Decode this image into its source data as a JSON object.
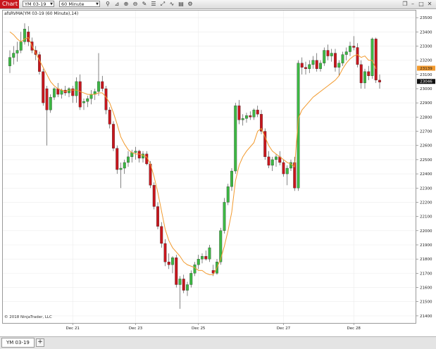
{
  "toolbar": {
    "tab_label": "Chart",
    "instrument": "YM 03-19",
    "interval": "60 Minute",
    "tools": [
      "search-icon",
      "zoom-in-icon",
      "zoom-out-icon",
      "bar-type-icon",
      "pen-icon",
      "properties-icon",
      "indicator-icon",
      "strategy-icon",
      "window-icon",
      "link-icon"
    ],
    "window_buttons": [
      "restore",
      "minimize",
      "maximize",
      "close"
    ]
  },
  "indicator_label": "afsRVMA(YM 03-19 (60 Minute),14)",
  "copyright": "© 2018 NinjaTrader, LLC",
  "bottom_tab": "YM 03-19",
  "add_tab": "+",
  "colors": {
    "up": "#3cb843",
    "down": "#c8161d",
    "ma": "#f29a2e",
    "last": "#111111"
  },
  "chart_data": {
    "type": "candlestick",
    "title": "",
    "ylim": [
      21350,
      23550
    ],
    "yticks": [
      21400,
      21500,
      21600,
      21700,
      21800,
      21900,
      22000,
      22100,
      22200,
      22300,
      22400,
      22500,
      22600,
      22700,
      22800,
      22900,
      23000,
      23100,
      23200,
      23300,
      23400,
      23500
    ],
    "xticks": [
      {
        "label": "Dec 21",
        "i": 17
      },
      {
        "label": "Dec 23",
        "i": 34
      },
      {
        "label": "Dec 25",
        "i": 51
      },
      {
        "label": "Dec 27",
        "i": 74
      },
      {
        "label": "Dec 28",
        "i": 93
      }
    ],
    "ma_badge": "23139",
    "last_badge": "23046",
    "candles": [
      [
        23160,
        23270,
        23110,
        23220
      ],
      [
        23220,
        23300,
        23170,
        23250
      ],
      [
        23250,
        23330,
        23190,
        23270
      ],
      [
        23270,
        23400,
        23250,
        23330
      ],
      [
        23330,
        23460,
        23310,
        23420
      ],
      [
        23400,
        23440,
        23300,
        23330
      ],
      [
        23330,
        23360,
        23250,
        23270
      ],
      [
        23270,
        23300,
        23200,
        23240
      ],
      [
        23240,
        23260,
        23100,
        23120
      ],
      [
        23120,
        23140,
        22880,
        22900
      ],
      [
        23000,
        23020,
        22600,
        22850
      ],
      [
        22850,
        22960,
        22830,
        22940
      ],
      [
        22940,
        23010,
        22920,
        23000
      ],
      [
        23000,
        23040,
        22940,
        22960
      ],
      [
        22960,
        23000,
        22930,
        22990
      ],
      [
        22990,
        23020,
        22950,
        22970
      ],
      [
        22970,
        23010,
        22940,
        23000
      ],
      [
        23000,
        23020,
        22900,
        22950
      ],
      [
        22950,
        23080,
        22900,
        23050
      ],
      [
        23050,
        23100,
        22850,
        22870
      ],
      [
        22900,
        22930,
        22850,
        22910
      ],
      [
        22910,
        22950,
        22870,
        22930
      ],
      [
        22930,
        22990,
        22890,
        22960
      ],
      [
        22960,
        23000,
        22920,
        22980
      ],
      [
        22980,
        23250,
        22950,
        23050
      ],
      [
        23050,
        23090,
        22980,
        23000
      ],
      [
        23000,
        23020,
        22820,
        22850
      ],
      [
        22850,
        22870,
        22720,
        22750
      ],
      [
        22750,
        22770,
        22560,
        22580
      ],
      [
        22580,
        22600,
        22400,
        22430
      ],
      [
        22430,
        22480,
        22300,
        22440
      ],
      [
        22440,
        22500,
        22400,
        22480
      ],
      [
        22480,
        22560,
        22450,
        22520
      ],
      [
        22520,
        22570,
        22480,
        22550
      ],
      [
        22550,
        22590,
        22500,
        22560
      ],
      [
        22560,
        22570,
        22480,
        22510
      ],
      [
        22510,
        22560,
        22480,
        22540
      ],
      [
        22540,
        22560,
        22460,
        22470
      ],
      [
        22470,
        22490,
        22300,
        22320
      ],
      [
        22320,
        22340,
        22150,
        22170
      ],
      [
        22170,
        22200,
        22010,
        22030
      ],
      [
        22030,
        22060,
        21880,
        21910
      ],
      [
        21910,
        21940,
        21750,
        21780
      ],
      [
        21780,
        21840,
        21730,
        21760
      ],
      [
        21760,
        21820,
        21700,
        21810
      ],
      [
        21810,
        21830,
        21600,
        21620
      ],
      [
        21620,
        21680,
        21450,
        21660
      ],
      [
        21660,
        21690,
        21560,
        21580
      ],
      [
        21580,
        21640,
        21540,
        21620
      ],
      [
        21620,
        21720,
        21600,
        21700
      ],
      [
        21700,
        21780,
        21680,
        21760
      ],
      [
        21760,
        21830,
        21730,
        21800
      ],
      [
        21800,
        21840,
        21770,
        21820
      ],
      [
        21820,
        21860,
        21790,
        21800
      ],
      [
        21800,
        21900,
        21780,
        21880
      ],
      [
        21720,
        21760,
        21680,
        21700
      ],
      [
        21700,
        21800,
        21690,
        21780
      ],
      [
        21780,
        22020,
        21760,
        22000
      ],
      [
        22000,
        22230,
        21980,
        22200
      ],
      [
        22200,
        22330,
        22180,
        22310
      ],
      [
        22310,
        22440,
        22280,
        22420
      ],
      [
        22420,
        22900,
        22400,
        22880
      ],
      [
        22880,
        22920,
        22750,
        22780
      ],
      [
        22780,
        22820,
        22740,
        22790
      ],
      [
        22790,
        22830,
        22760,
        22810
      ],
      [
        22810,
        22840,
        22780,
        22800
      ],
      [
        22800,
        22860,
        22780,
        22850
      ],
      [
        22850,
        22880,
        22800,
        22820
      ],
      [
        22820,
        22850,
        22680,
        22700
      ],
      [
        22700,
        22720,
        22500,
        22520
      ],
      [
        22520,
        22560,
        22440,
        22460
      ],
      [
        22460,
        22520,
        22420,
        22500
      ],
      [
        22500,
        22540,
        22450,
        22520
      ],
      [
        22520,
        22560,
        22460,
        22480
      ],
      [
        22480,
        22500,
        22380,
        22400
      ],
      [
        22400,
        22460,
        22320,
        22440
      ],
      [
        22440,
        22500,
        22420,
        22480
      ],
      [
        22480,
        22520,
        22280,
        22300
      ],
      [
        22300,
        23200,
        22280,
        23180
      ],
      [
        23180,
        23220,
        23100,
        23150
      ],
      [
        23150,
        23190,
        23100,
        23140
      ],
      [
        23140,
        23200,
        23110,
        23170
      ],
      [
        23170,
        23230,
        23140,
        23200
      ],
      [
        23200,
        23250,
        23120,
        23140
      ],
      [
        23140,
        23200,
        23120,
        23180
      ],
      [
        23180,
        23290,
        23160,
        23270
      ],
      [
        23270,
        23310,
        23200,
        23230
      ],
      [
        23230,
        23280,
        23190,
        23250
      ],
      [
        23250,
        23280,
        23120,
        23150
      ],
      [
        23150,
        23200,
        23090,
        23180
      ],
      [
        23180,
        23260,
        23160,
        23240
      ],
      [
        23240,
        23290,
        23200,
        23260
      ],
      [
        23260,
        23330,
        23230,
        23300
      ],
      [
        23300,
        23370,
        23270,
        23290
      ],
      [
        23290,
        23320,
        23150,
        23170
      ],
      [
        23170,
        23200,
        23000,
        23040
      ],
      [
        23040,
        23140,
        23000,
        23120
      ],
      [
        23120,
        23160,
        23060,
        23090
      ],
      [
        23090,
        23360,
        23070,
        23350
      ],
      [
        23350,
        23360,
        23040,
        23060
      ],
      [
        23060,
        23100,
        23000,
        23046
      ]
    ],
    "ma": [
      23400,
      23380,
      23350,
      23330,
      23350,
      23360,
      23300,
      23250,
      23200,
      23150,
      23100,
      23050,
      23020,
      23000,
      22990,
      22980,
      22990,
      22990,
      22990,
      22980,
      22970,
      22960,
      22960,
      22960,
      22970,
      22970,
      22940,
      22900,
      22830,
      22750,
      22660,
      22610,
      22570,
      22550,
      22540,
      22540,
      22530,
      22520,
      22470,
      22380,
      22270,
      22140,
      22010,
      21930,
      21880,
      21850,
      21820,
      21780,
      21760,
      21750,
      21740,
      21720,
      21720,
      21700,
      21690,
      21690,
      21740,
      21800,
      21890,
      22000,
      22130,
      22350,
      22460,
      22520,
      22560,
      22590,
      22620,
      22700,
      22720,
      22660,
      22600,
      22560,
      22540,
      22520,
      22500,
      22480,
      22470,
      22450,
      22790,
      22850,
      22880,
      22910,
      22940,
      22960,
      22980,
      23000,
      23020,
      23040,
      23060,
      23090,
      23140,
      23180,
      23210,
      23230,
      23240,
      23220,
      23230,
      23200,
      23200,
      23139
    ]
  }
}
